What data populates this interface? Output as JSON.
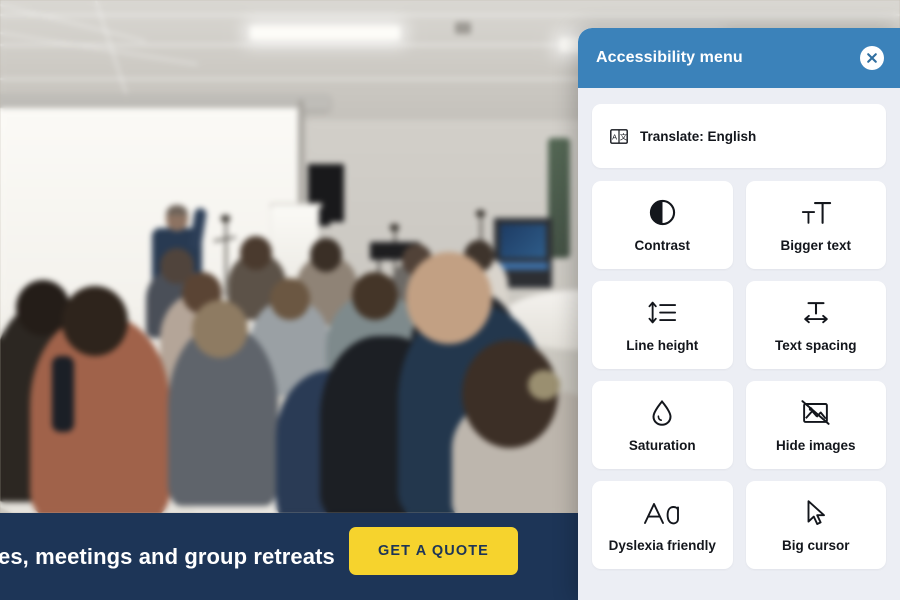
{
  "page": {
    "hero": {
      "alt_description": "conference room with speaker and seated audience"
    },
    "bottom_bar": {
      "tagline": "es, meetings and group retreats",
      "cta_label": "GET A QUOTE",
      "bar_color": "#1d3557",
      "cta_color": "#f6d32d",
      "cta_text_color": "#1d3557"
    }
  },
  "accessibility_panel": {
    "title": "Accessibility menu",
    "header_color": "#3b82ba",
    "body_color": "#eceef4",
    "card_color": "#ffffff",
    "close_icon": "close-icon",
    "translate": {
      "icon": "translate-icon",
      "label": "Translate: English"
    },
    "options": [
      {
        "icon": "contrast-icon",
        "label": "Contrast"
      },
      {
        "icon": "bigger-text-icon",
        "label": "Bigger text"
      },
      {
        "icon": "line-height-icon",
        "label": "Line height"
      },
      {
        "icon": "text-spacing-icon",
        "label": "Text spacing"
      },
      {
        "icon": "saturation-icon",
        "label": "Saturation"
      },
      {
        "icon": "hide-images-icon",
        "label": "Hide images"
      },
      {
        "icon": "dyslexia-icon",
        "label": "Dyslexia friendly"
      },
      {
        "icon": "big-cursor-icon",
        "label": "Big cursor"
      }
    ]
  }
}
